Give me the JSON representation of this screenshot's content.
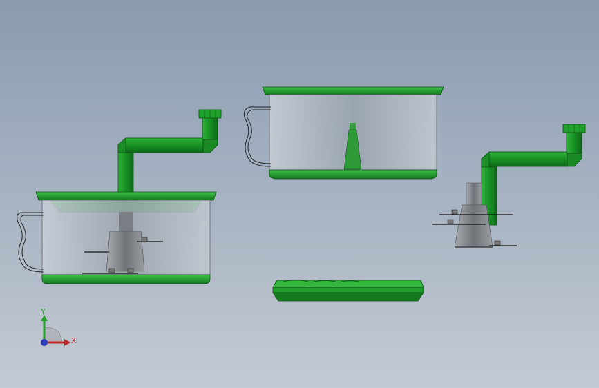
{
  "viewport": {
    "background_top": "#8a9bb0",
    "background_bottom": "#c4cad3"
  },
  "colors": {
    "part_green": "#1f9a2a",
    "part_green_dark": "#0e5c16",
    "part_green_light": "#3fc24a",
    "glass": "#b9bfc8",
    "cone_gray": "#8c8f94",
    "outline": "#1a1a1a"
  },
  "triad": {
    "x_label": "X",
    "y_label": "Y",
    "x_color": "#c0282d",
    "y_color": "#2aa12f",
    "z_color": "#2b3bb5"
  },
  "views": [
    {
      "name": "isometric-assembly-view"
    },
    {
      "name": "top-container-view"
    },
    {
      "name": "right-pipe-assembly-view"
    },
    {
      "name": "bottom-tray-view"
    }
  ]
}
